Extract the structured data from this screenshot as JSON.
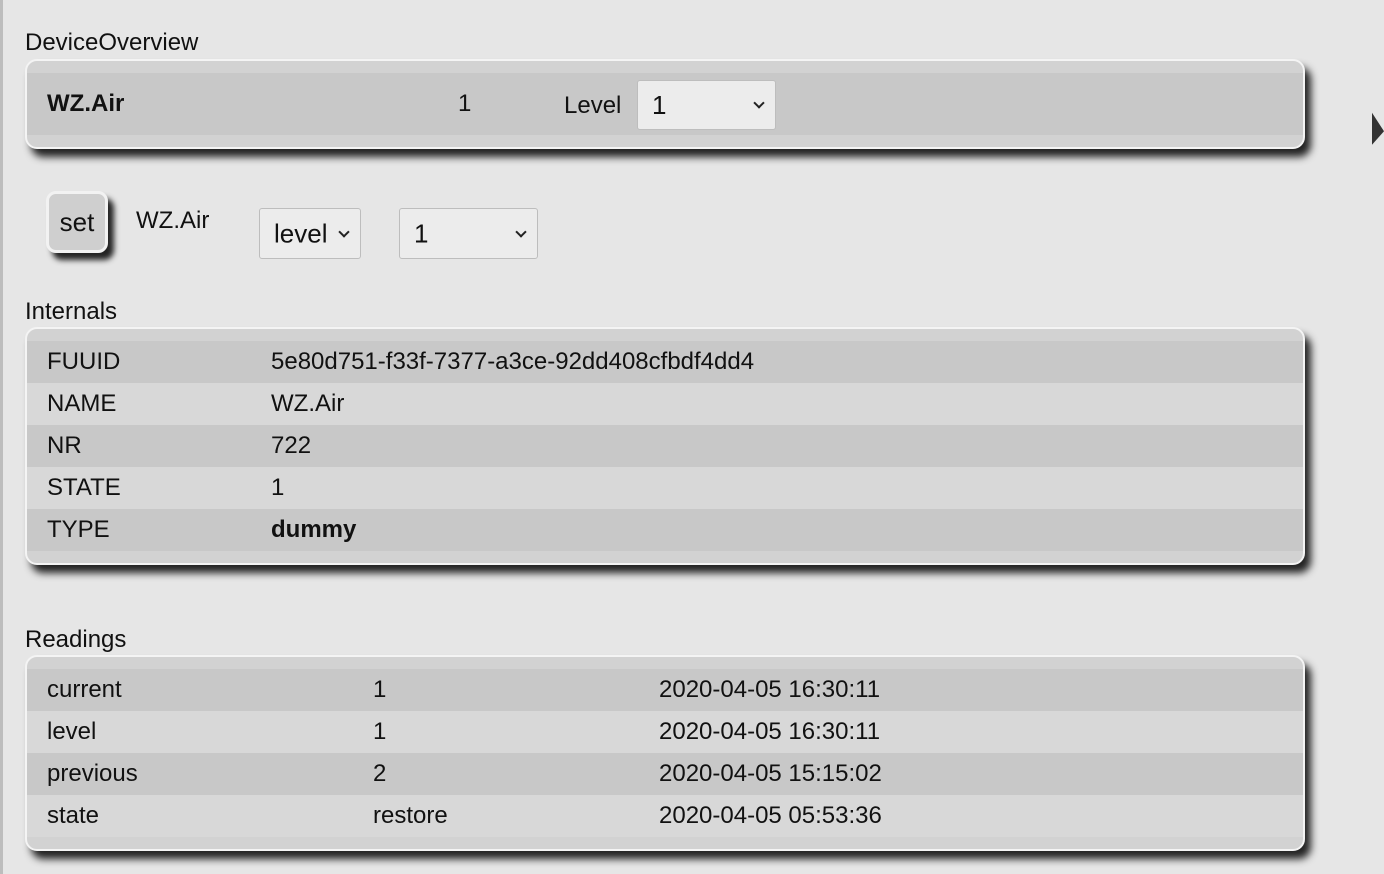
{
  "overview": {
    "title": "DeviceOverview",
    "device_name": "WZ.Air",
    "state": "1",
    "level_label": "Level",
    "level_selected": "1"
  },
  "command": {
    "set_label": "set",
    "device": "WZ.Air",
    "attribute_selected": "level",
    "value_selected": "1"
  },
  "internals": {
    "title": "Internals",
    "rows": [
      {
        "key": "FUUID",
        "value": "5e80d751-f33f-7377-a3ce-92dd408cfbdf4dd4"
      },
      {
        "key": "NAME",
        "value": "WZ.Air"
      },
      {
        "key": "NR",
        "value": "722"
      },
      {
        "key": "STATE",
        "value": "1"
      },
      {
        "key": "TYPE",
        "value": "dummy"
      }
    ]
  },
  "readings": {
    "title": "Readings",
    "rows": [
      {
        "name": "current",
        "value": "1",
        "time": "2020-04-05 16:30:11"
      },
      {
        "name": "level",
        "value": "1",
        "time": "2020-04-05 16:30:11"
      },
      {
        "name": "previous",
        "value": "2",
        "time": "2020-04-05 15:15:02"
      },
      {
        "name": "state",
        "value": "restore",
        "time": "2020-04-05 05:53:36"
      }
    ]
  }
}
